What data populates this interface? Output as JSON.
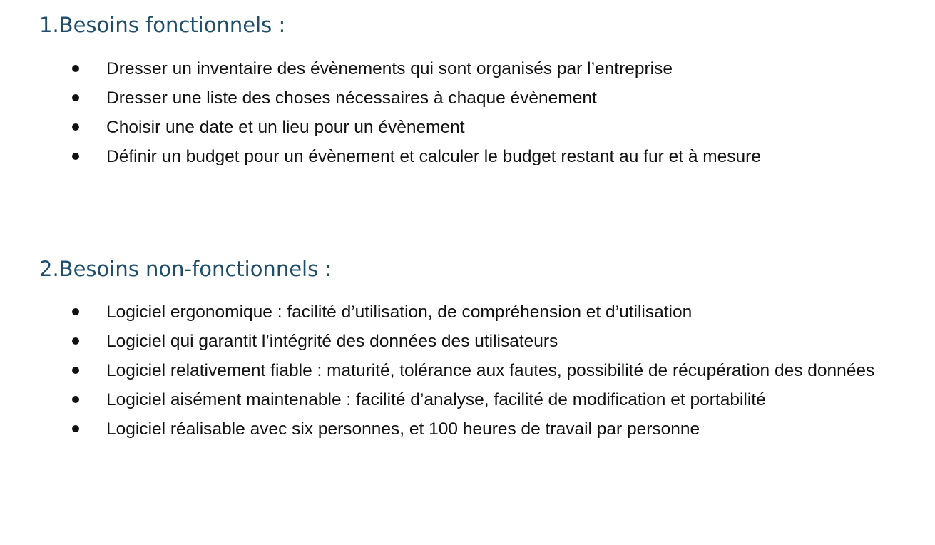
{
  "document": {
    "sections": [
      {
        "heading": "1.Besoins fonctionnels :",
        "items": [
          "Dresser un inventaire des évènements qui sont organisés par l’entreprise",
          "Dresser une liste des choses nécessaires à chaque évènement",
          "Choisir une date et un lieu pour un évènement",
          "Définir un budget pour un évènement et calculer le budget restant au fur et à mesure"
        ]
      },
      {
        "heading": "2.Besoins non-fonctionnels :",
        "items": [
          "Logiciel ergonomique : facilité d’utilisation, de compréhension et d’utilisation",
          "Logiciel qui garantit l’intégrité des données des utilisateurs",
          "Logiciel relativement fiable : maturité, tolérance aux fautes, possibilité de récupération des données",
          "Logiciel aisément maintenable : facilité d’analyse, facilité de modification et portabilité",
          "Logiciel réalisable avec six personnes, et 100 heures de travail par personne"
        ]
      }
    ]
  }
}
